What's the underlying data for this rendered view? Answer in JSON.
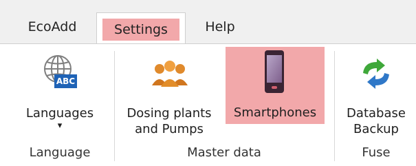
{
  "tabs": {
    "ecoadd": "EcoAdd",
    "settings": "Settings",
    "help": "Help"
  },
  "ribbon": {
    "languages": {
      "label": "Languages",
      "badge": "ABC",
      "arrow": "▾",
      "icon": "globe-abc-icon"
    },
    "dosing": {
      "line1": "Dosing plants",
      "line2": "and Pumps",
      "icon": "people-group-icon"
    },
    "smartphones": {
      "label": "Smartphones",
      "icon": "smartphone-icon"
    },
    "database": {
      "line1": "Database",
      "line2": "Backup",
      "icon": "sync-arrows-icon"
    },
    "groups": {
      "language": "Language",
      "master_data": "Master data",
      "fuse": "Fuse"
    }
  },
  "colors": {
    "highlight": "#f2a8aa",
    "tab_bar": "#f0f0f0",
    "badge_blue": "#1f63b6",
    "sync_green": "#3fa83a",
    "sync_blue": "#2f78c8"
  }
}
